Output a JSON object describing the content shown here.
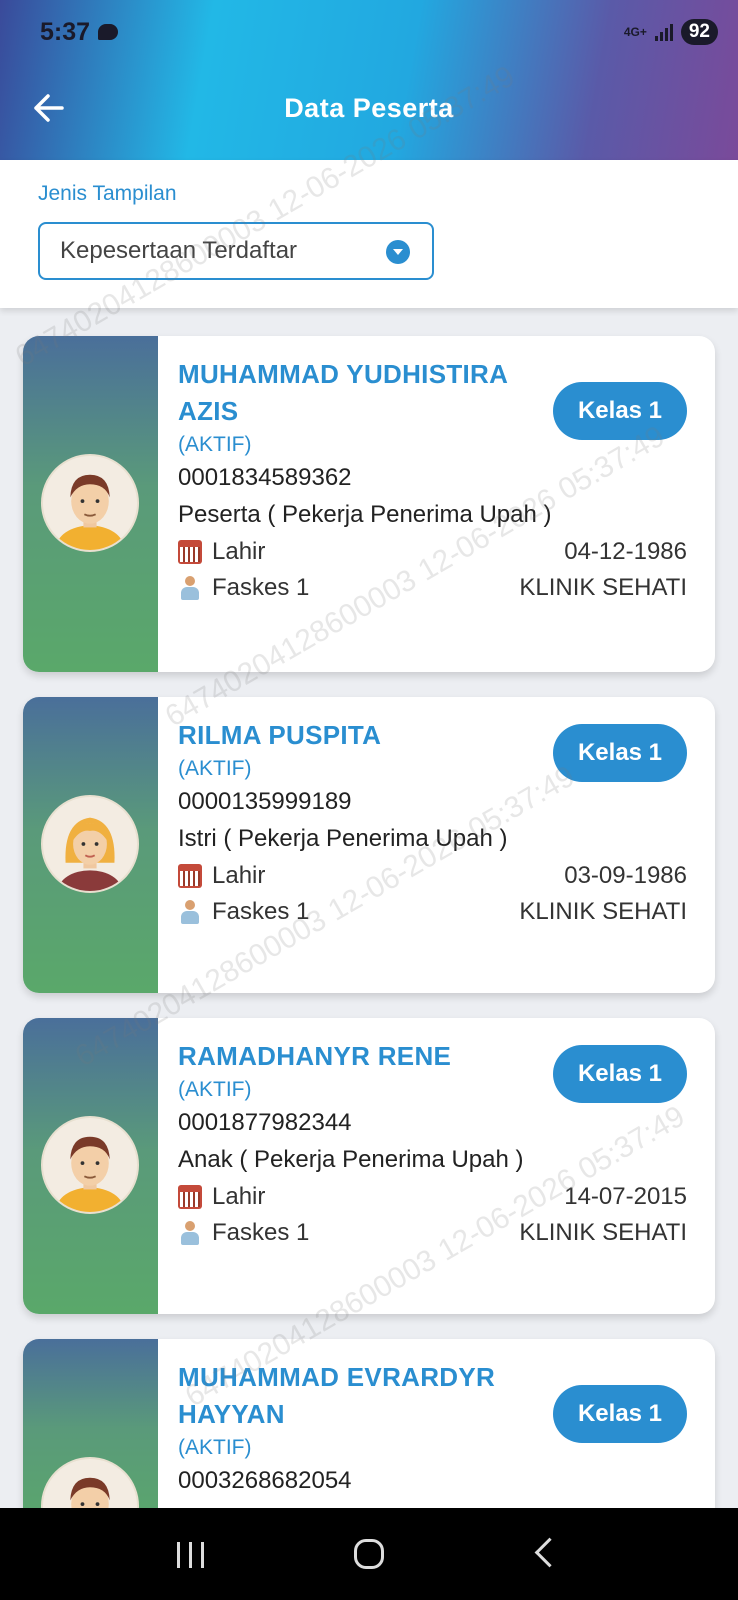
{
  "status_bar": {
    "time": "5:37",
    "network": "4G+",
    "battery": "92"
  },
  "header": {
    "title": "Data Peserta"
  },
  "filter": {
    "label": "Jenis Tampilan",
    "selected": "Kepesertaan Terdaftar"
  },
  "members": [
    {
      "name": "MUHAMMAD YUDHISTIRA AZIS",
      "status": "(AKTIF)",
      "number": "0001834589362",
      "relation": "Peserta   ( Pekerja Penerima Upah )",
      "kelas": "Kelas 1",
      "lahir_label": "Lahir",
      "lahir": "04-12-1986",
      "faskes_label": "Faskes 1",
      "faskes": "KLINIK SEHATI",
      "avatar": "male-avatar"
    },
    {
      "name": "RILMA PUSPITA",
      "status": "(AKTIF)",
      "number": "0000135999189",
      "relation": "Istri   ( Pekerja Penerima Upah )",
      "kelas": "Kelas 1",
      "lahir_label": "Lahir",
      "lahir": "03-09-1986",
      "faskes_label": "Faskes 1",
      "faskes": "KLINIK SEHATI",
      "avatar": "female-avatar"
    },
    {
      "name": "RAMADHANYR RENE",
      "status": "(AKTIF)",
      "number": "0001877982344",
      "relation": "Anak   ( Pekerja Penerima Upah )",
      "kelas": "Kelas 1",
      "lahir_label": "Lahir",
      "lahir": "14-07-2015",
      "faskes_label": "Faskes 1",
      "faskes": "KLINIK SEHATI",
      "avatar": "male-avatar"
    },
    {
      "name": "MUHAMMAD EVRARDYR HAYYAN",
      "status": "(AKTIF)",
      "number": "0003268682054",
      "kelas": "Kelas 1",
      "avatar": "male-avatar"
    }
  ],
  "watermark": "64740204128600003 12-06-2026 05:37:49",
  "colors": {
    "accent": "#2a8ed0",
    "card_side_top": "#4a6f9a",
    "card_side_bottom": "#5aa86a"
  }
}
